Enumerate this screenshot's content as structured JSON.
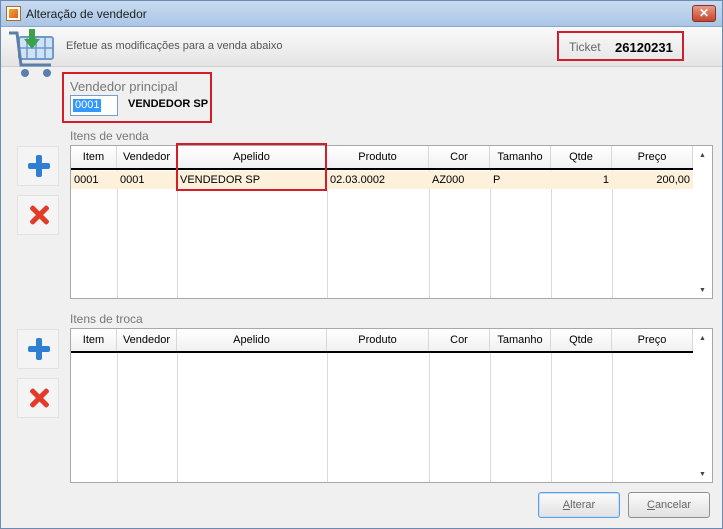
{
  "window": {
    "title": "Alteração de vendedor",
    "close_label": "✕"
  },
  "header": {
    "message": "Efetue as modificações para a venda abaixo",
    "ticket_label": "Ticket",
    "ticket_value": "26120231"
  },
  "vendor": {
    "label": "Vendedor principal",
    "code": "0001",
    "name": "VENDEDOR SP"
  },
  "sales": {
    "title": "Itens de venda",
    "columns": [
      "Item",
      "Vendedor",
      "Apelido",
      "Produto",
      "Cor",
      "Tamanho",
      "Qtde",
      "Preço"
    ],
    "rows": [
      {
        "item": "0001",
        "vendedor": "0001",
        "apelido": "VENDEDOR SP",
        "produto": "02.03.0002",
        "cor": "AZ000",
        "tamanho": "P",
        "qtde": "1",
        "preco": "200,00"
      }
    ]
  },
  "exchange": {
    "title": "Itens de troca",
    "columns": [
      "Item",
      "Vendedor",
      "Apelido",
      "Produto",
      "Cor",
      "Tamanho",
      "Qtde",
      "Preço"
    ]
  },
  "buttons": {
    "alterar": "Alterar",
    "alterar_mnemonic": "A",
    "alterar_rest": "lterar",
    "cancelar": "Cancelar",
    "cancelar_mnemonic": "C",
    "cancelar_rest": "ancelar"
  },
  "colors": {
    "highlight": "#d21e2b",
    "selected_row": "#fdf1dc",
    "accent_blue": "#2f7fd3",
    "delete_red": "#e23b2a"
  },
  "icons": [
    "shopping-cart-icon",
    "add-icon",
    "delete-icon",
    "scroll-up-icon",
    "scroll-down-icon"
  ]
}
